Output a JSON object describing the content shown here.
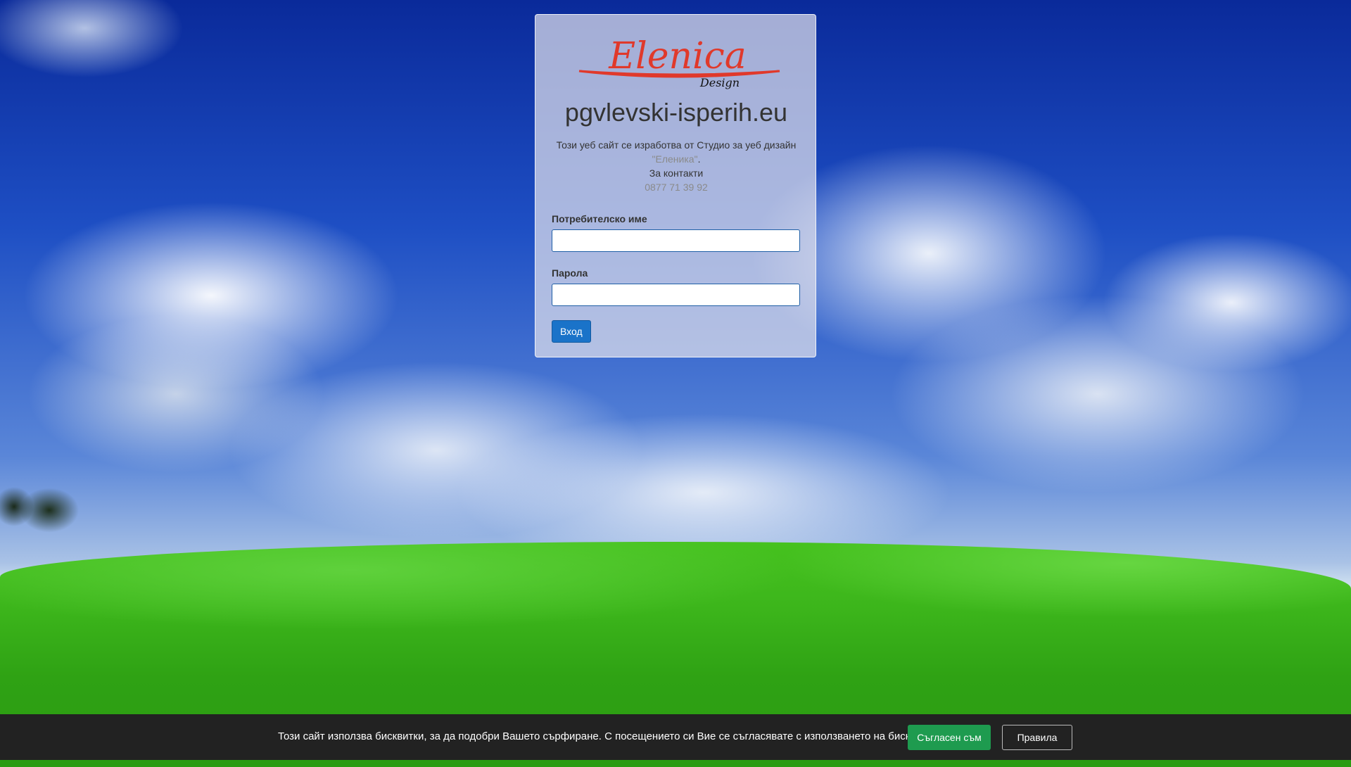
{
  "brand": {
    "logo_main": "Elenica",
    "logo_sub": "Design",
    "logo_accent_color": "#e0392b"
  },
  "site_title": "pgvlevski-isperih.eu",
  "info": {
    "line1": "Този уеб сайт се изработва от Студио за уеб дизайн",
    "studio_name": "\"Еленика\"",
    "studio_suffix": ".",
    "contacts_label": "За контакти",
    "phone": "0877 71 39 92"
  },
  "login_form": {
    "username_label": "Потребителско име",
    "username_value": "",
    "password_label": "Парола",
    "password_value": "",
    "submit_label": "Вход"
  },
  "cookie_bar": {
    "text": "Този сайт използва бисквитки, за да подобри Вашето сърфиране. С посещението си Вие се съгласявате с използването на бисквитки!",
    "agree_label": "Съгласен съм",
    "rules_label": "Правила"
  },
  "colors": {
    "primary_button": "#1a73c9",
    "agree_button": "#1e9b4f",
    "cookie_bar_bg": "#222222"
  }
}
